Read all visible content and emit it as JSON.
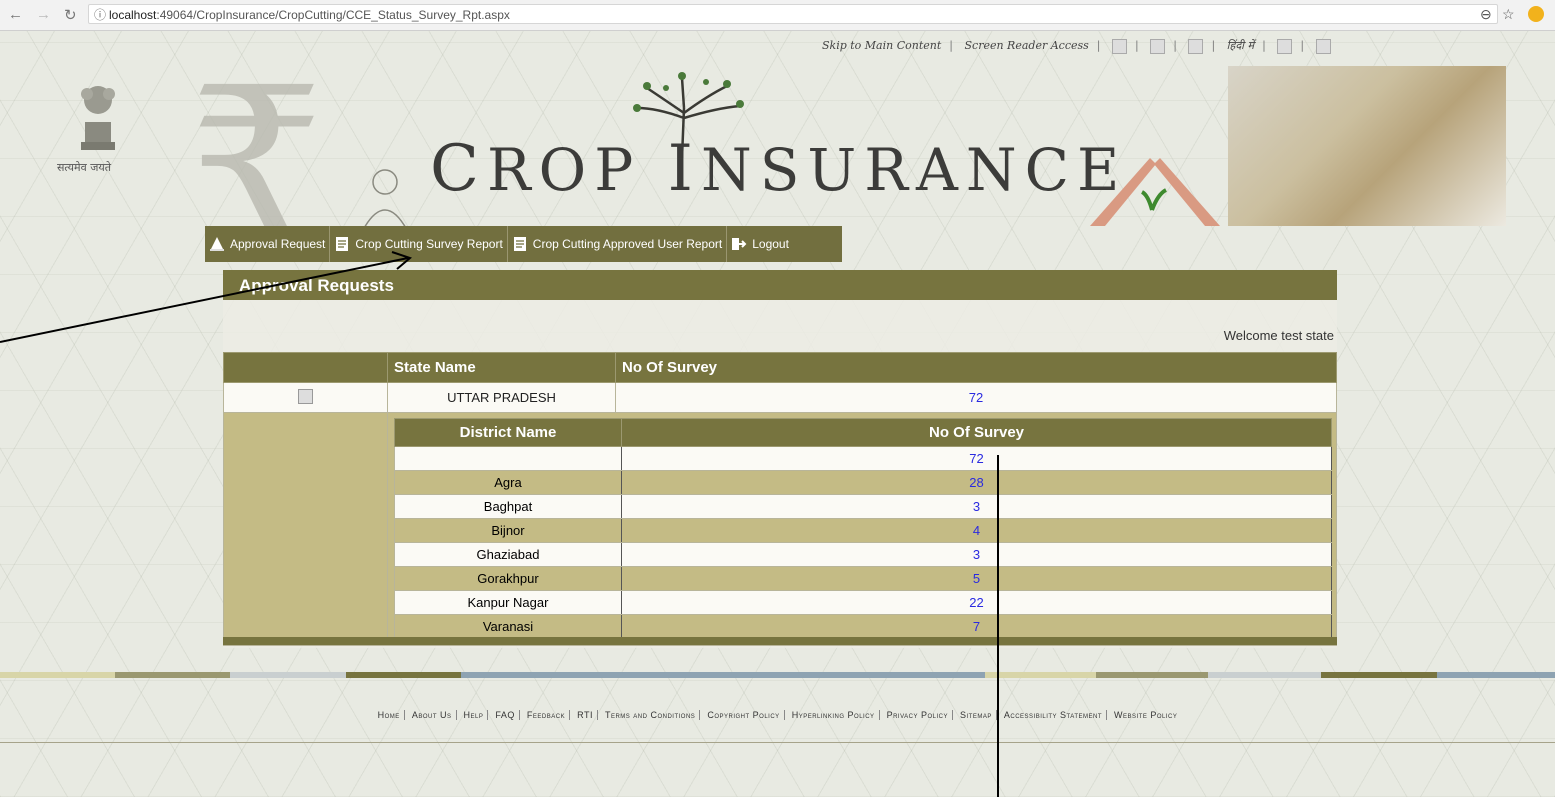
{
  "browser": {
    "url_host": "localhost",
    "url_rest": ":49064/CropInsurance/CropCutting/CCE_Status_Survey_Rpt.aspx"
  },
  "top_links": {
    "skip": "Skip to Main Content",
    "screen_reader": "Screen Reader Access",
    "hindi": "हिंदी में"
  },
  "header": {
    "emblem_text": "सत्यमेव जयते",
    "title_c": "C",
    "title_rop": "ROP",
    "title_i": "I",
    "title_nsurance": "NSURANCE"
  },
  "menu": {
    "items": [
      {
        "label": "Approval Request",
        "icon": "tent-icon"
      },
      {
        "label": "Crop Cutting Survey Report",
        "icon": "document-icon"
      },
      {
        "label": "Crop Cutting Approved User Report",
        "icon": "document-icon"
      },
      {
        "label": "Logout",
        "icon": "logout-icon"
      }
    ]
  },
  "panel": {
    "title": "Approval Requests",
    "welcome": "Welcome test state"
  },
  "state_table": {
    "headers": [
      "",
      "State Name",
      "No Of Survey"
    ],
    "row": {
      "state": "UTTAR PRADESH",
      "count": "72"
    }
  },
  "district_table": {
    "headers": [
      "District Name",
      "No Of Survey"
    ],
    "rows": [
      {
        "district": "",
        "count": "72"
      },
      {
        "district": "Agra",
        "count": "28"
      },
      {
        "district": "Baghpat",
        "count": "3"
      },
      {
        "district": "Bijnor",
        "count": "4"
      },
      {
        "district": "Ghaziabad",
        "count": "3"
      },
      {
        "district": "Gorakhpur",
        "count": "5"
      },
      {
        "district": "Kanpur Nagar",
        "count": "22"
      },
      {
        "district": "Varanasi",
        "count": "7"
      }
    ]
  },
  "footer": {
    "links": [
      "Home",
      "About Us",
      "Help",
      "FAQ",
      "Feedback",
      "RTI",
      "Terms and Conditions",
      "Copyright Policy",
      "Hyperlinking Policy",
      "Privacy Policy",
      "Sitemap",
      "Accessibility Statement",
      "Website Policy"
    ]
  },
  "colors": {
    "olive": "#77743f",
    "olive_light": "#c4bb85",
    "link": "#2a2ae0"
  }
}
